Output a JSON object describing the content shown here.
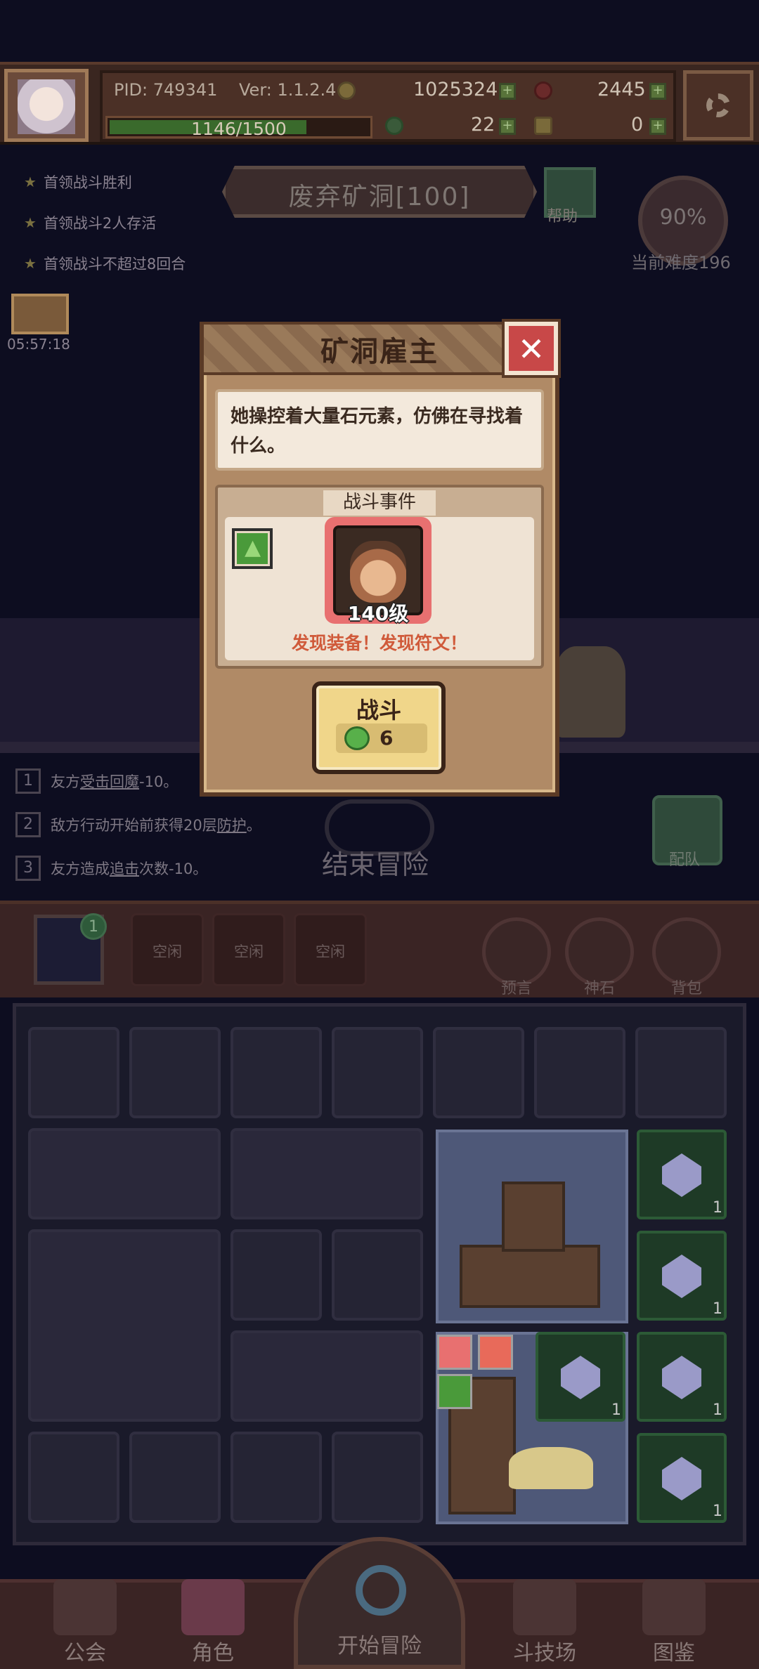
{
  "hud": {
    "pid": "PID: 749341",
    "version": "Ver: 1.1.2.4",
    "gold": "1025324",
    "gems": "2445",
    "hp": "1146/1500",
    "hp_fraction": 0.764,
    "clover": "22",
    "item": "0"
  },
  "goals": [
    "首领战斗胜利",
    "首领战斗2人存活",
    "首领战斗不超过8回合"
  ],
  "timer": "05:57:18",
  "stage": {
    "title": "废弃矿洞[100]",
    "help": "帮助"
  },
  "difficulty": {
    "percent": "90%",
    "label": "当前难度196"
  },
  "effects": [
    {
      "num": "1",
      "text_a": "友方",
      "link": "受击回魔",
      "text_b": "-10。"
    },
    {
      "num": "2",
      "text_a": "敌方行动开始前获得20层",
      "link": "防护",
      "text_b": "。"
    },
    {
      "num": "3",
      "text_a": "友方造成",
      "link": "追击",
      "text_b": "次数-10。"
    }
  ],
  "end_adventure": "结束冒险",
  "team": "配队",
  "party": {
    "badge": "1",
    "slots": [
      "空闲",
      "空闲",
      "空闲"
    ],
    "buttons": [
      "预言",
      "神石",
      "背包"
    ]
  },
  "inventory": {
    "gem_counts": [
      "1",
      "1",
      "1",
      "1",
      "1"
    ]
  },
  "nav": [
    "公会",
    "角色",
    "开始冒险",
    "斗技场",
    "图鉴"
  ],
  "modal": {
    "title": "矿洞雇主",
    "close": "✕",
    "description": "她操控着大量石元素，仿佛在寻找着什么。",
    "event_label": "战斗事件",
    "level": "140级",
    "discover": "发现装备！发现符文！",
    "fight": "战斗",
    "cost": "6"
  },
  "colors": {
    "accent_red": "#c84848",
    "discover_text": "#d05a3a",
    "fight_button": "#f0d68a",
    "gem_green": "#58b04a"
  }
}
